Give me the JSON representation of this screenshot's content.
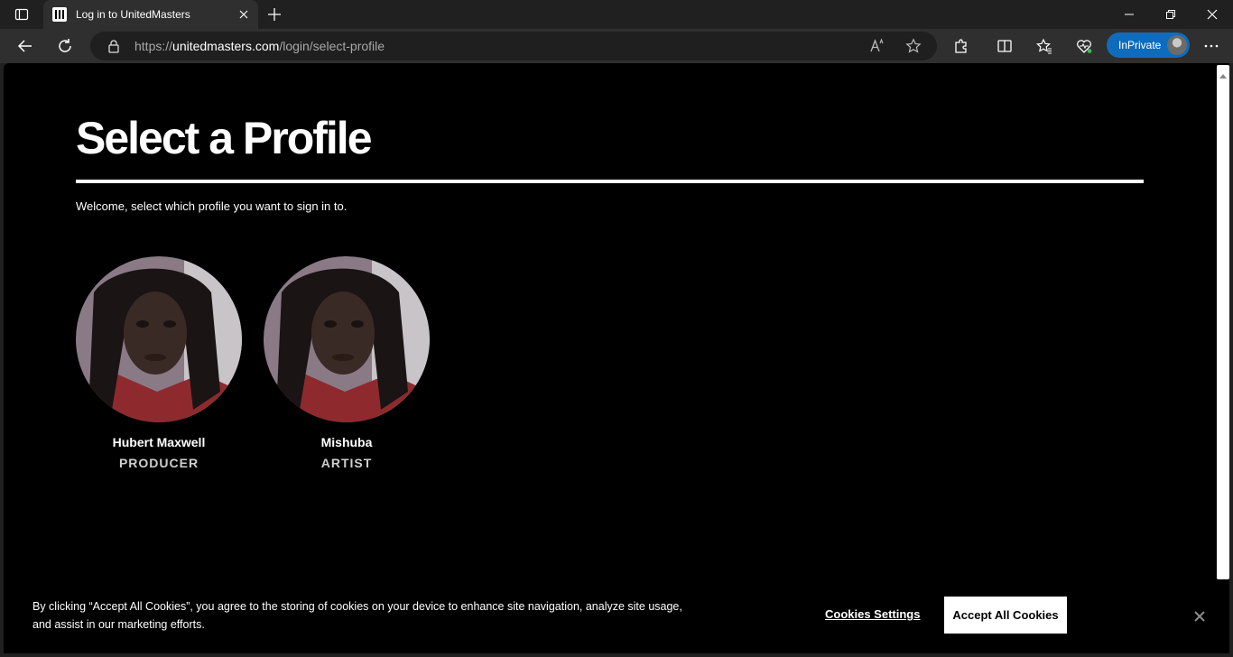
{
  "browser": {
    "tab_title": "Log in to UnitedMasters",
    "url_prefix": "https://",
    "url_host": "unitedmasters.com",
    "url_path": "/login/select-profile",
    "inprivate_label": "InPrivate"
  },
  "page": {
    "heading": "Select a Profile",
    "welcome": "Welcome, select which profile you want to sign in to.",
    "profiles": [
      {
        "name": "Hubert Maxwell",
        "role": "PRODUCER"
      },
      {
        "name": "Mishuba",
        "role": "ARTIST"
      }
    ]
  },
  "cookie_banner": {
    "text": "By clicking “Accept All Cookies”, you agree to the storing of cookies on your device to enhance site navigation, analyze site usage, and assist in our marketing efforts.",
    "settings_label": "Cookies Settings",
    "accept_label": "Accept All Cookies"
  },
  "icons": {
    "tab_actions": "tab-actions-icon",
    "favicon": "unitedmasters-logo-icon",
    "close": "close-icon",
    "new_tab": "plus-icon",
    "back": "back-arrow-icon",
    "refresh": "refresh-icon",
    "lock": "lock-icon",
    "read_aloud": "read-aloud-icon",
    "favorite": "star-icon",
    "extensions": "puzzle-icon",
    "split_screen": "split-screen-icon",
    "favorites": "favorites-icon",
    "health": "browser-essentials-icon",
    "more": "more-icon"
  },
  "colors": {
    "inprivate": "#0f6cbd",
    "page_background": "#000000"
  }
}
